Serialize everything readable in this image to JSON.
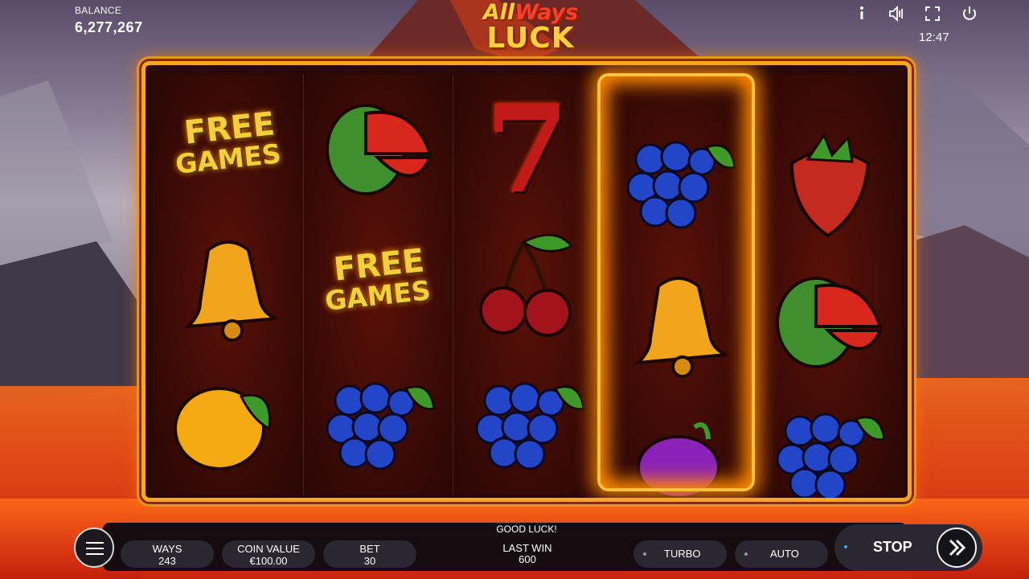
{
  "header": {
    "balance_label": "BALANCE",
    "balance_value": "6,277,267",
    "logo_line1_all": "All",
    "logo_line1_ways": "Ways",
    "logo_line2": "LUCK",
    "clock": "12:47",
    "icons": [
      "info-icon",
      "sound-icon",
      "fullscreen-icon",
      "power-icon"
    ]
  },
  "reels": [
    [
      "free-games",
      "bell",
      "lemon"
    ],
    [
      "watermelon",
      "free-games",
      "grapes"
    ],
    [
      "seven",
      "cherries",
      "grapes"
    ],
    [
      "grapes",
      "bell",
      "plum"
    ],
    [
      "strawberry",
      "watermelon",
      "grapes"
    ]
  ],
  "symbols": {
    "free_line1": "FREE",
    "free_line2": "GAMES",
    "seven": "7"
  },
  "controls": {
    "message": "GOOD LUCK!",
    "ways_label": "WAYS",
    "ways_value": "243",
    "coin_label": "COIN VALUE",
    "coin_value": "€100.00",
    "bet_label": "BET",
    "bet_value": "30",
    "lastwin_label": "LAST WIN",
    "lastwin_value": "600",
    "turbo_label": "TURBO",
    "auto_label": "AUTO",
    "stop_label": "STOP"
  },
  "colors": {
    "frame_gold": "#f5a623",
    "reel_bg": "#3a0a06",
    "accent_blue": "#39a6ff",
    "logo_yellow": "#ffd23a"
  }
}
